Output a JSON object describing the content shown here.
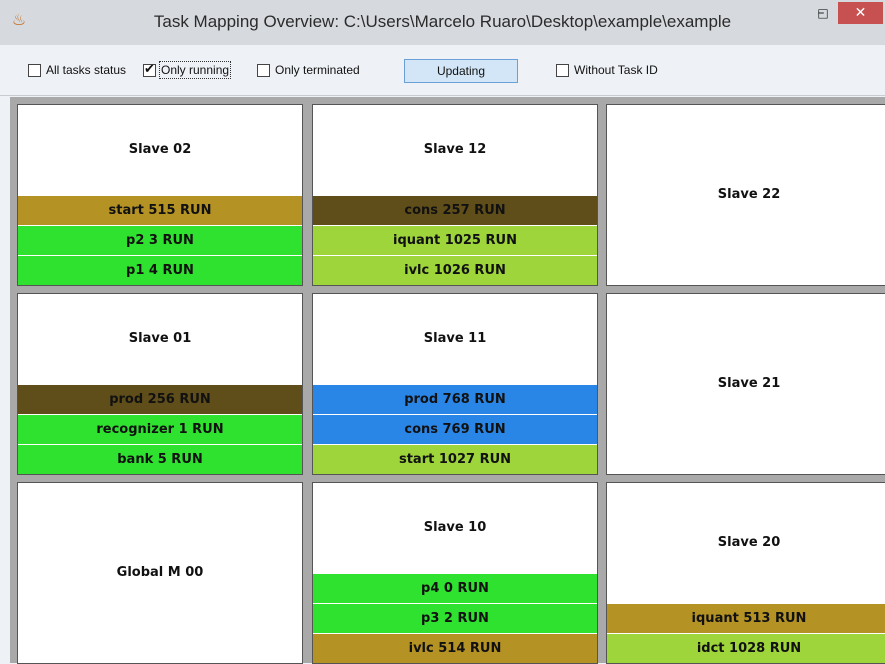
{
  "window": {
    "title": "Task Mapping Overview: C:\\Users\\Marcelo Ruaro\\Desktop\\example\\example",
    "app_icon": "java-cup-icon",
    "controls": {
      "minimize": "–",
      "maximize": "□",
      "close": "✕"
    }
  },
  "toolbar": {
    "all_tasks_status": {
      "label": "All tasks status",
      "checked": false
    },
    "only_running": {
      "label": "Only running",
      "checked": true
    },
    "only_terminated": {
      "label": "Only terminated",
      "checked": false
    },
    "updating_button": "Updating",
    "without_task_id": {
      "label": "Without Task ID",
      "checked": false
    }
  },
  "colors": {
    "gold": "#b49224",
    "dark_olive": "#5f4e1a",
    "bright_green": "#2fe22f",
    "lime": "#9ed53b",
    "blue": "#2a86e6"
  },
  "processors": [
    {
      "name": "Slave 02",
      "tasks": [
        {
          "label": "start  515  RUN",
          "color": "#b49224"
        },
        {
          "label": "p2  3  RUN",
          "color": "#2fe22f"
        },
        {
          "label": "p1  4  RUN",
          "color": "#2fe22f"
        }
      ]
    },
    {
      "name": "Slave 12",
      "tasks": [
        {
          "label": "cons  257  RUN",
          "color": "#5f4e1a"
        },
        {
          "label": "iquant  1025  RUN",
          "color": "#9ed53b"
        },
        {
          "label": "ivlc  1026  RUN",
          "color": "#9ed53b"
        }
      ]
    },
    {
      "name": "Slave 22",
      "tasks": []
    },
    {
      "name": "Slave 01",
      "tasks": [
        {
          "label": "prod  256  RUN",
          "color": "#5f4e1a"
        },
        {
          "label": "recognizer  1  RUN",
          "color": "#2fe22f"
        },
        {
          "label": "bank  5  RUN",
          "color": "#2fe22f"
        }
      ]
    },
    {
      "name": "Slave 11",
      "tasks": [
        {
          "label": "prod  768  RUN",
          "color": "#2a86e6"
        },
        {
          "label": "cons  769  RUN",
          "color": "#2a86e6"
        },
        {
          "label": "start  1027  RUN",
          "color": "#9ed53b"
        }
      ]
    },
    {
      "name": "Slave 21",
      "tasks": []
    },
    {
      "name": "Global M 00",
      "tasks": []
    },
    {
      "name": "Slave 10",
      "tasks": [
        {
          "label": "p4  0  RUN",
          "color": "#2fe22f"
        },
        {
          "label": "p3  2  RUN",
          "color": "#2fe22f"
        },
        {
          "label": "ivlc  514  RUN",
          "color": "#b49224"
        }
      ]
    },
    {
      "name": "Slave 20",
      "tasks": [
        {
          "label": "iquant  513  RUN",
          "color": "#b49224"
        },
        {
          "label": "idct  1028  RUN",
          "color": "#9ed53b"
        }
      ]
    }
  ]
}
